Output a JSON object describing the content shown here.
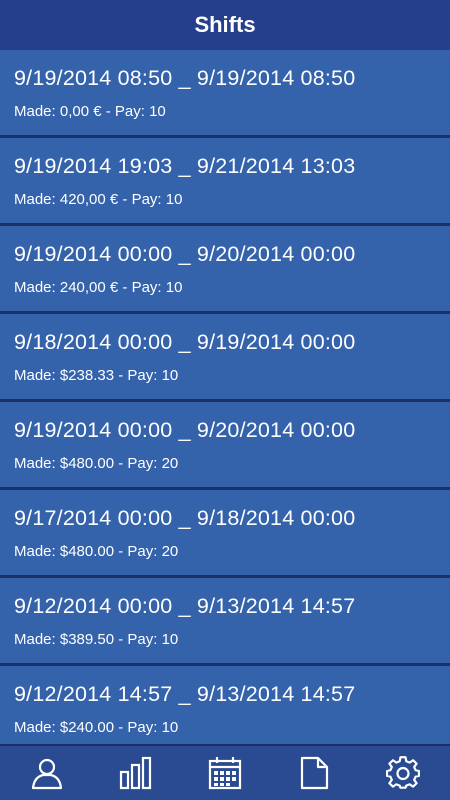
{
  "header": {
    "title": "Shifts"
  },
  "shifts": [
    {
      "range": "9/19/2014 08:50 _ 9/19/2014 08:50",
      "meta": "Made: 0,00 € - Pay: 10"
    },
    {
      "range": "9/19/2014 19:03 _ 9/21/2014 13:03",
      "meta": "Made: 420,00 € - Pay: 10"
    },
    {
      "range": "9/19/2014 00:00 _ 9/20/2014 00:00",
      "meta": "Made: 240,00 € - Pay: 10"
    },
    {
      "range": "9/18/2014 00:00 _ 9/19/2014 00:00",
      "meta": "Made: $238.33 - Pay: 10"
    },
    {
      "range": "9/19/2014 00:00 _ 9/20/2014 00:00",
      "meta": "Made: $480.00 - Pay: 20"
    },
    {
      "range": "9/17/2014 00:00 _ 9/18/2014 00:00",
      "meta": "Made: $480.00 - Pay: 20"
    },
    {
      "range": "9/12/2014 00:00 _ 9/13/2014 14:57",
      "meta": "Made: $389.50 - Pay: 10"
    },
    {
      "range": "9/12/2014 14:57 _ 9/13/2014 14:57",
      "meta": "Made: $240.00 - Pay: 10"
    }
  ],
  "nav": {
    "items": [
      {
        "icon": "person-icon"
      },
      {
        "icon": "bar-chart-icon"
      },
      {
        "icon": "calendar-icon"
      },
      {
        "icon": "document-icon"
      },
      {
        "icon": "gear-icon"
      }
    ]
  },
  "colors": {
    "header_bg": "#263f8c",
    "row_bg": "#3462ab",
    "separator": "#1c2f66",
    "nav_bg": "#2a4b92"
  }
}
